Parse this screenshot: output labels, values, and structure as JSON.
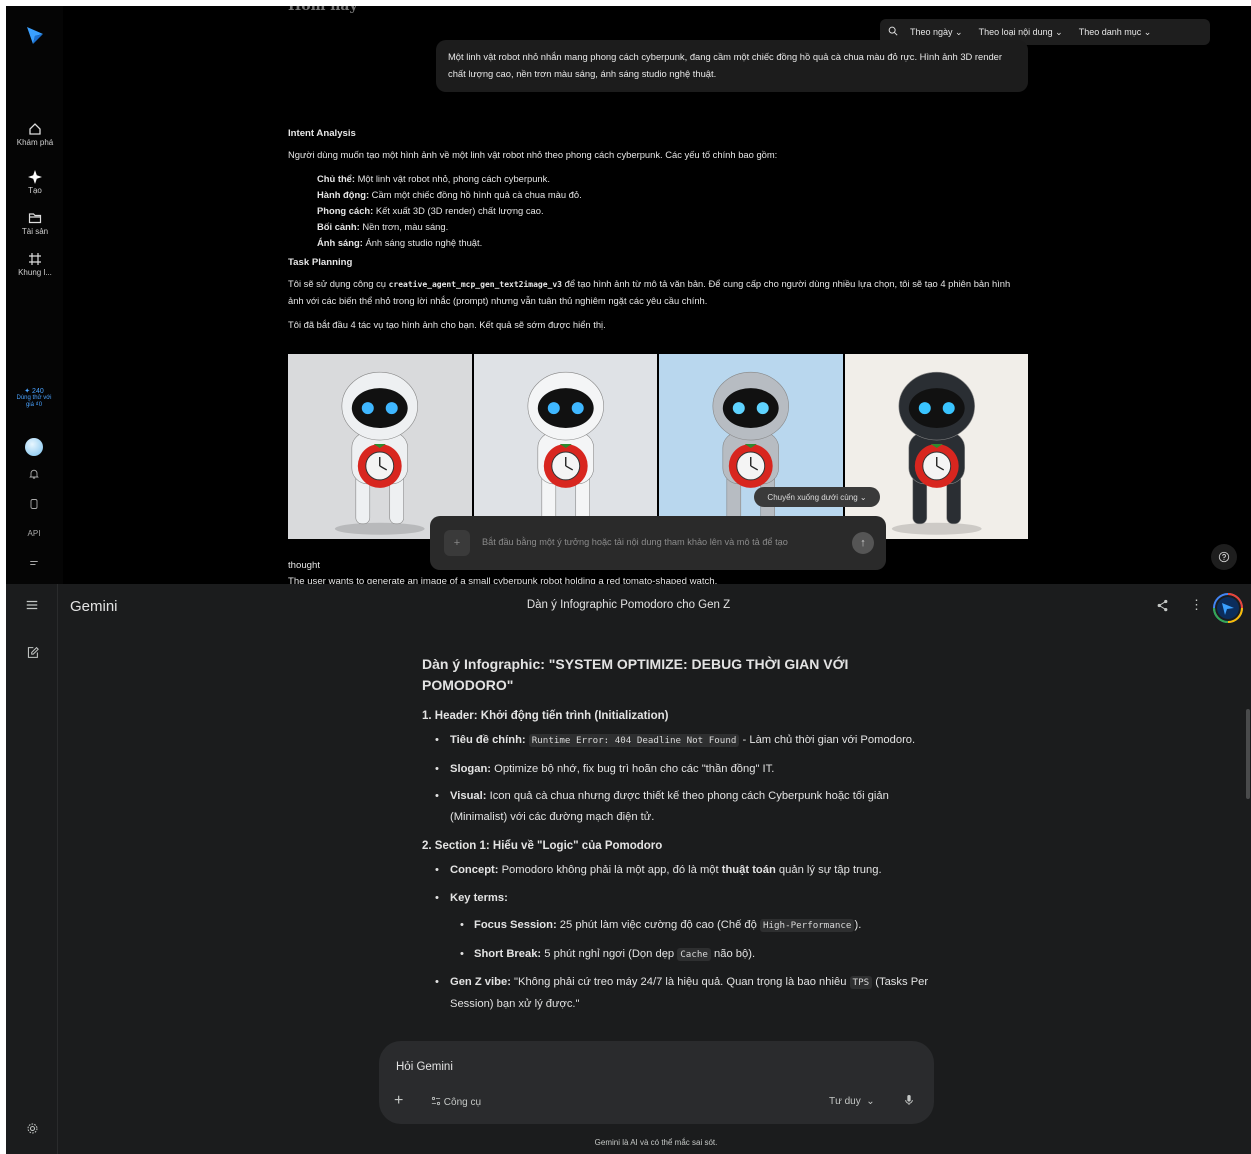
{
  "top_app": {
    "partial_header": "Hôm nay",
    "rail": {
      "explore": "Khám phá",
      "create": "Tạo",
      "assets": "Tài sản",
      "frames": "Khung l...",
      "credits": "✦ 240",
      "trial": "Dùng thử với giá ₫0",
      "api": "API"
    },
    "filters": {
      "by_date": "Theo ngày",
      "by_content_type": "Theo loại nội dung",
      "by_category": "Theo danh mục"
    },
    "user_prompt": "Một linh vật robot nhỏ nhắn mang phong cách cyberpunk, đang cầm một chiếc đồng hồ quả cà chua màu đỏ rực. Hình ảnh 3D render chất lượng cao, nền trơn màu sáng, ánh sáng studio nghệ thuật.",
    "response": {
      "intent_heading": "Intent Analysis",
      "intent_intro": "Người dùng muốn tạo một hình ảnh về một linh vật robot nhỏ theo phong cách cyberpunk. Các yếu tố chính bao gồm:",
      "intent_items": [
        {
          "label": "Chủ thể:",
          "text": " Một linh vật robot nhỏ, phong cách cyberpunk."
        },
        {
          "label": "Hành động:",
          "text": " Cầm một chiếc đồng hồ hình quả cà chua màu đỏ."
        },
        {
          "label": "Phong cách:",
          "text": " Kết xuất 3D (3D render) chất lượng cao."
        },
        {
          "label": "Bối cảnh:",
          "text": " Nền trơn, màu sáng."
        },
        {
          "label": "Ánh sáng:",
          "text": " Ánh sáng studio nghệ thuật."
        }
      ],
      "planning_heading": "Task Planning",
      "planning_pre": "Tôi sẽ sử dụng công cụ ",
      "planning_tool": "creative_agent_mcp_gen_text2image_v3",
      "planning_post": " để tạo hình ảnh từ mô tả văn bản. Để cung cấp cho người dùng nhiều lựa chọn, tôi sẽ tạo 4 phiên bản hình ảnh với các biến thể nhỏ trong lời nhắc (prompt) nhưng vẫn tuân thủ nghiêm ngặt các yêu cầu chính.",
      "started": "Tôi đã bắt đầu 4 tác vụ tạo hình ảnh cho bạn. Kết quả sẽ sớm được hiển thị."
    },
    "images": [
      {
        "bg": "#d9dadc",
        "body": "#eef0f2",
        "eye": "#3fb7ff"
      },
      {
        "bg": "#dfe2e6",
        "body": "#f4f5f6",
        "eye": "#3fb7ff"
      },
      {
        "bg": "#b9d7ee",
        "body": "#b7bcc2",
        "eye": "#5fd3ff"
      },
      {
        "bg": "#f1eee9",
        "body": "#2a2e33",
        "eye": "#39c4ff"
      }
    ],
    "scroll_chip": "Chuyển xuống dưới cùng",
    "input_placeholder": "Bắt đầu bằng một ý tưởng hoặc tải nội dung tham khảo lên và mô tả để tạo",
    "thought_label": "thought",
    "thought_text": "The user wants to generate an image of a small cyberpunk robot holding a red tomato-shaped watch."
  },
  "gemini": {
    "brand": "Gemini",
    "chat_title": "Dàn ý Infographic Pomodoro cho Gen Z",
    "doc": {
      "title": "Dàn ý Infographic: \"SYSTEM OPTIMIZE: DEBUG THỜI GIAN VỚI POMODORO\"",
      "s1_heading": "1. Header: Khởi động tiến trình (Initialization)",
      "s1_title_label": "Tiêu đề chính:",
      "s1_title_code": "Runtime Error: 404 Deadline Not Found",
      "s1_title_rest": " - Làm chủ thời gian với Pomodoro.",
      "s1_slogan_label": "Slogan:",
      "s1_slogan_text": " Optimize bộ nhớ, fix bug trì hoãn cho các \"thần đồng\" IT.",
      "s1_visual_label": "Visual:",
      "s1_visual_text": " Icon quả cà chua nhưng được thiết kế theo phong cách Cyberpunk hoặc tối giản (Minimalist) với các đường mạch điện tử.",
      "s2_heading": "2. Section 1: Hiểu về \"Logic\" của Pomodoro",
      "s2_concept_label": "Concept:",
      "s2_concept_pre": " Pomodoro không phải là một app, đó là một ",
      "s2_concept_bold": "thuật toán",
      "s2_concept_post": " quản lý sự tập trung.",
      "s2_keyterms_label": "Key terms:",
      "s2_focus_label": "Focus Session:",
      "s2_focus_pre": " 25 phút làm việc cường độ cao (Chế độ ",
      "s2_focus_code": "High-Performance",
      "s2_focus_post": ").",
      "s2_break_label": "Short Break:",
      "s2_break_pre": " 5 phút nghỉ ngơi (Dọn dẹp ",
      "s2_break_code": "Cache",
      "s2_break_post": " não bộ).",
      "s2_genz_label": "Gen Z vibe:",
      "s2_genz_pre": " \"Không phải cứ treo máy 24/7 là hiệu quả. Quan trọng là bao nhiêu ",
      "s2_genz_code": "TPS",
      "s2_genz_post": " (Tasks Per Session) bạn xử lý được.\""
    },
    "input_placeholder": "Hỏi Gemini",
    "tools_label": "Công cụ",
    "mode_label": "Tư duy",
    "disclaimer": "Gemini là AI và có thể mắc sai sót."
  }
}
